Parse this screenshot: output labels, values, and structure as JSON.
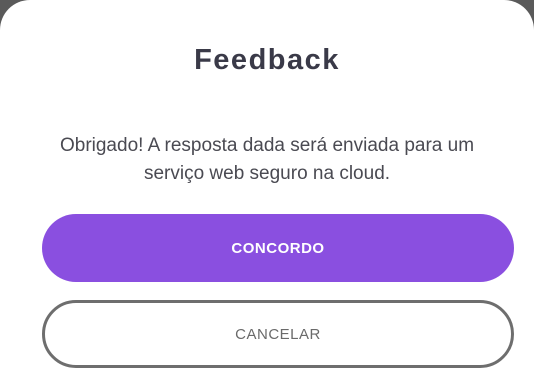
{
  "dialog": {
    "title": "Feedback",
    "message": "Obrigado! A resposta dada será enviada para um serviço web seguro na cloud.",
    "confirm_label": "CONCORDO",
    "cancel_label": "CANCELAR"
  },
  "colors": {
    "primary": "#8a4fe0",
    "title_text": "#3a3a48",
    "cancel_border": "#6e6e6e"
  }
}
